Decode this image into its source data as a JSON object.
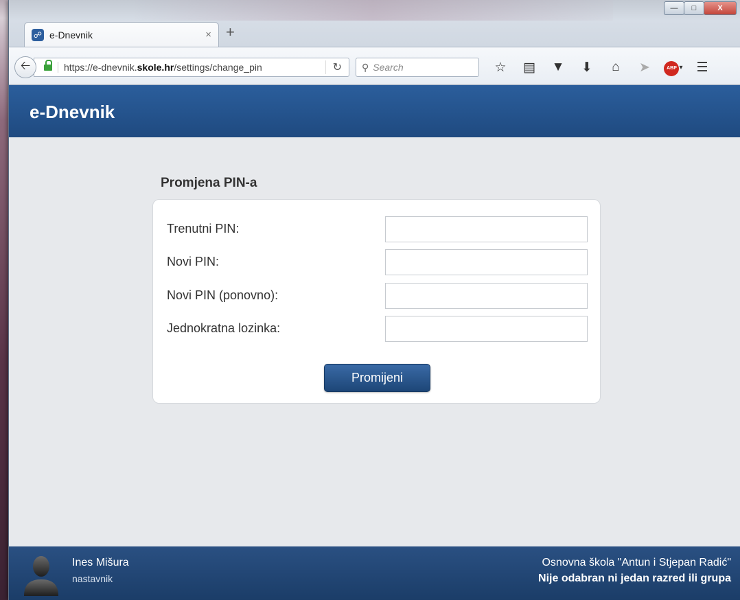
{
  "browser": {
    "tab_title": "e-Dnevnik",
    "tab_close": "×",
    "new_tab": "+",
    "url_prefix": "https://e-dnevnik.",
    "url_domain": "skole.hr",
    "url_path": "/settings/change_pin",
    "search_placeholder": "Search",
    "window_controls": {
      "minimize": "—",
      "maximize": "□",
      "close": "X"
    },
    "abp_label": "ABP"
  },
  "app": {
    "title": "e-Dnevnik"
  },
  "form": {
    "section_title": "Promjena PIN-a",
    "fields": [
      {
        "label": "Trenutni PIN:",
        "value": ""
      },
      {
        "label": "Novi PIN:",
        "value": ""
      },
      {
        "label": "Novi PIN (ponovno):",
        "value": ""
      },
      {
        "label": "Jednokratna lozinka:",
        "value": ""
      }
    ],
    "submit_label": "Promijeni"
  },
  "footer": {
    "user_name": "Ines Mišura",
    "user_role": "nastavnik",
    "school_name": "Osnovna škola \"Antun i Stjepan Radić\"",
    "class_status": "Nije odabran ni jedan razred ili grupa"
  },
  "colors": {
    "header_blue": "#2b5e9c",
    "footer_blue": "#1b3d68",
    "content_bg": "#e7e9ec",
    "button_blue": "#1d4677"
  }
}
